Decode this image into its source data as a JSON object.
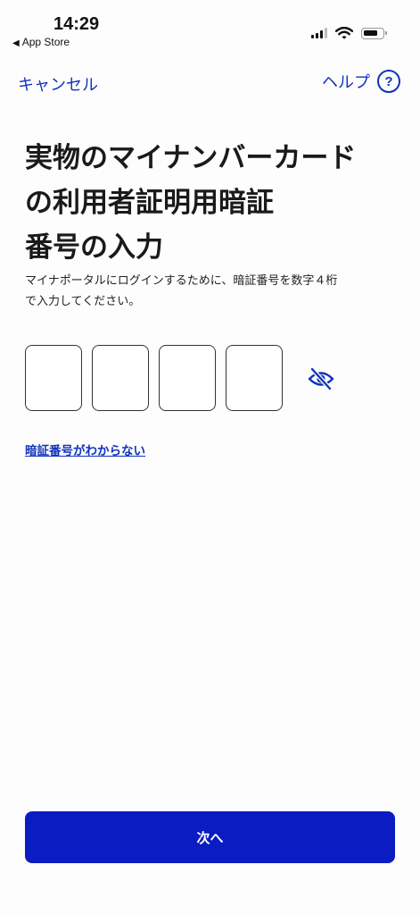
{
  "status_bar": {
    "time": "14:29",
    "back_label": "App Store",
    "back_icon": "triangle-left-icon",
    "icons": [
      "cellular-signal-icon",
      "wifi-icon",
      "battery-icon"
    ]
  },
  "nav": {
    "cancel_label": "キャンセル",
    "help_label": "ヘルプ",
    "help_icon_glyph": "?"
  },
  "title": {
    "line1": "実物のマイナンバーカード",
    "line2": "の利用者証明用暗証",
    "line3": "番号の入力"
  },
  "description": {
    "line1": "マイナポータルにログインするために、暗証番号を数字４桁",
    "line2": "で入力してください。"
  },
  "pin": {
    "digits": [
      "",
      "",
      "",
      ""
    ],
    "visibility_icon": "eye-slash-icon"
  },
  "forgot_link": "暗証番号がわからない",
  "next_button": "次へ",
  "colors": {
    "accent": "#1133bb",
    "primary_button": "#0a1cc2",
    "text": "#1a1a1a",
    "background": "#fdfdfd"
  }
}
